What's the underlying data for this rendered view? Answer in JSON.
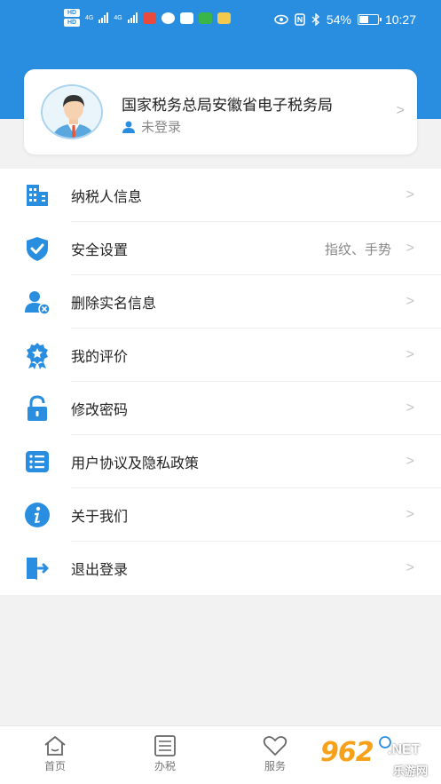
{
  "statusbar": {
    "battery_percent": "54%",
    "time": "10:27",
    "network_labels": [
      "HD",
      "HD",
      "4G",
      "4G"
    ],
    "battery_level": 0.54
  },
  "profile": {
    "org_name": "国家税务总局安徽省电子税务局",
    "login_status": "未登录"
  },
  "menu": {
    "items": [
      {
        "label": "纳税人信息",
        "value": "",
        "icon": "building-icon"
      },
      {
        "label": "安全设置",
        "value": "指纹、手势",
        "icon": "shield-check-icon"
      },
      {
        "label": "删除实名信息",
        "value": "",
        "icon": "user-remove-icon"
      },
      {
        "label": "我的评价",
        "value": "",
        "icon": "award-star-icon"
      },
      {
        "label": "修改密码",
        "value": "",
        "icon": "lock-icon"
      },
      {
        "label": "用户协议及隐私政策",
        "value": "",
        "icon": "list-icon"
      },
      {
        "label": "关于我们",
        "value": "",
        "icon": "info-icon"
      },
      {
        "label": "退出登录",
        "value": "",
        "icon": "logout-icon"
      }
    ]
  },
  "tabbar": {
    "tabs": [
      {
        "label": "首页",
        "icon": "home-icon"
      },
      {
        "label": "办税",
        "icon": "tax-list-icon"
      },
      {
        "label": "服务",
        "icon": "heart-icon"
      }
    ]
  },
  "watermark": {
    "number": "962",
    "suffix": ".NET",
    "text": "乐游网"
  },
  "colors": {
    "primary": "#2a8ee0",
    "background": "#f2f2f2",
    "watermark_orange": "#f7a11a"
  }
}
